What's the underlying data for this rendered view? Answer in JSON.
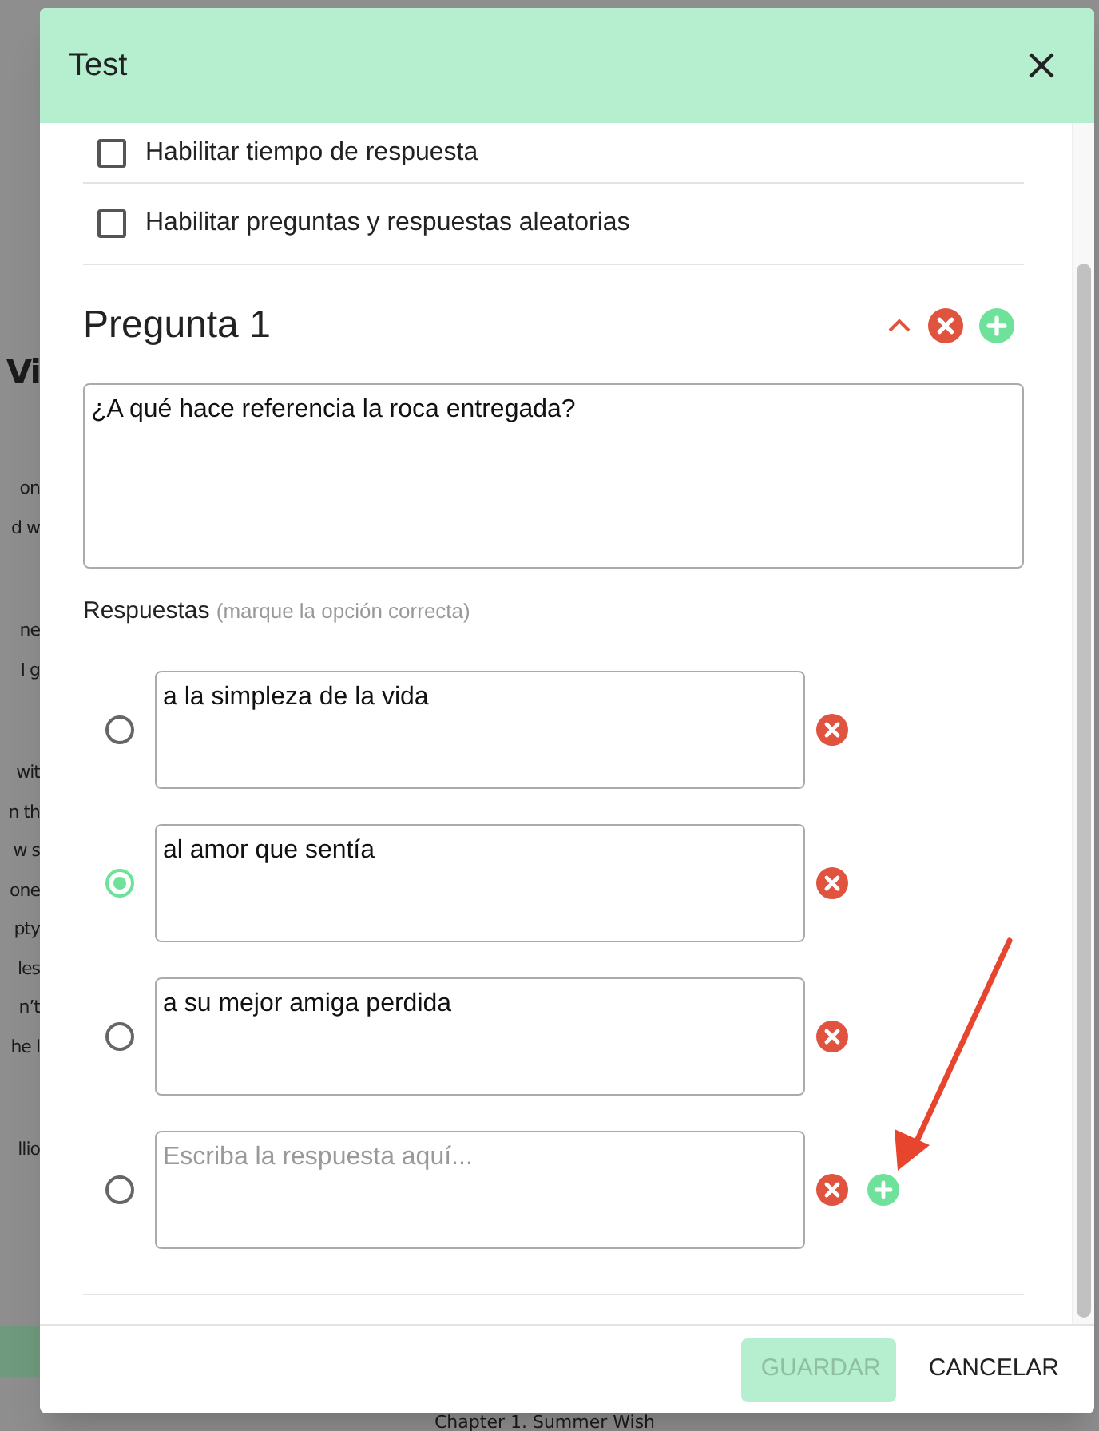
{
  "background": {
    "heading": "Vi",
    "paragraphs": [
      [
        "on",
        "d w"
      ],
      [
        "ne",
        "I g"
      ],
      [
        "wit",
        "n th",
        "w s",
        "one",
        "pty",
        "les",
        "n’t",
        "he l"
      ],
      [
        "llio"
      ]
    ],
    "footer_text": "Chapter 1. Summer Wish"
  },
  "dialog": {
    "title": "Test",
    "options": [
      {
        "label": "Habilitar tiempo de respuesta",
        "checked": false
      },
      {
        "label": "Habilitar preguntas y respuestas aleatorias",
        "checked": false
      }
    ],
    "question": {
      "title": "Pregunta 1",
      "text": "¿A qué hace referencia la roca entregada?",
      "answers_label": "Respuestas",
      "answers_hint": "(marque la opción correcta)",
      "answers": [
        {
          "value": "a la simpleza de la vida",
          "selected": false
        },
        {
          "value": "al amor que sentía",
          "selected": true
        },
        {
          "value": "a su mejor amiga perdida",
          "selected": false
        },
        {
          "placeholder": "Escriba la respuesta aquí...",
          "selected": false,
          "addable": true
        }
      ]
    },
    "buttons": [
      {
        "label": "GUARDAR",
        "kind": "primary",
        "disabled": true
      },
      {
        "label": "CANCELAR",
        "kind": "text",
        "disabled": false
      }
    ]
  }
}
